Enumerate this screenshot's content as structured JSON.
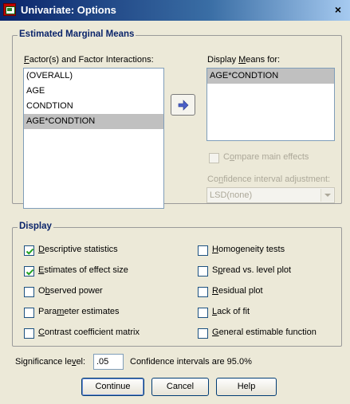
{
  "window": {
    "title": "Univariate: Options",
    "close_glyph": "×",
    "icons": {
      "app": "spss-window-icon",
      "close": "close-icon"
    }
  },
  "emm": {
    "legend": "Estimated Marginal Means",
    "factors_label": "Factor(s) and Factor Interactions:",
    "factors": [
      "(OVERALL)",
      "AGE",
      "CONDTION",
      "AGE*CONDTION"
    ],
    "factors_selected_index": 3,
    "display_label": "Display Means for:",
    "display_items": [
      "AGE*CONDTION"
    ],
    "move_button_icon": "arrow-right-icon",
    "compare_label": "Compare main effects",
    "compare_checked": false,
    "ci_adjust_label": "Confidence interval adjustment:",
    "ci_adjust_value": "LSD(none)"
  },
  "display": {
    "legend": "Display",
    "left": [
      {
        "label": "Descriptive statistics",
        "checked": true
      },
      {
        "label": "Estimates of effect size",
        "checked": true
      },
      {
        "label": "Observed power",
        "checked": false
      },
      {
        "label": "Parameter estimates",
        "checked": false
      },
      {
        "label": "Contrast coefficient matrix",
        "checked": false
      }
    ],
    "right": [
      {
        "label": "Homogeneity tests",
        "checked": false
      },
      {
        "label": "Spread vs. level plot",
        "checked": false
      },
      {
        "label": "Residual plot",
        "checked": false
      },
      {
        "label": "Lack of fit",
        "checked": false
      },
      {
        "label": "General estimable function",
        "checked": false
      }
    ]
  },
  "significance": {
    "label": "Significance level:",
    "value": ".05",
    "ci_text": "Confidence intervals are 95.0%"
  },
  "buttons": {
    "continue": "Continue",
    "cancel": "Cancel",
    "help": "Help"
  },
  "colors": {
    "title_start": "#0a246a",
    "legend": "#0a246a",
    "selection": "#c0c0c0",
    "face": "#ece9d8"
  }
}
